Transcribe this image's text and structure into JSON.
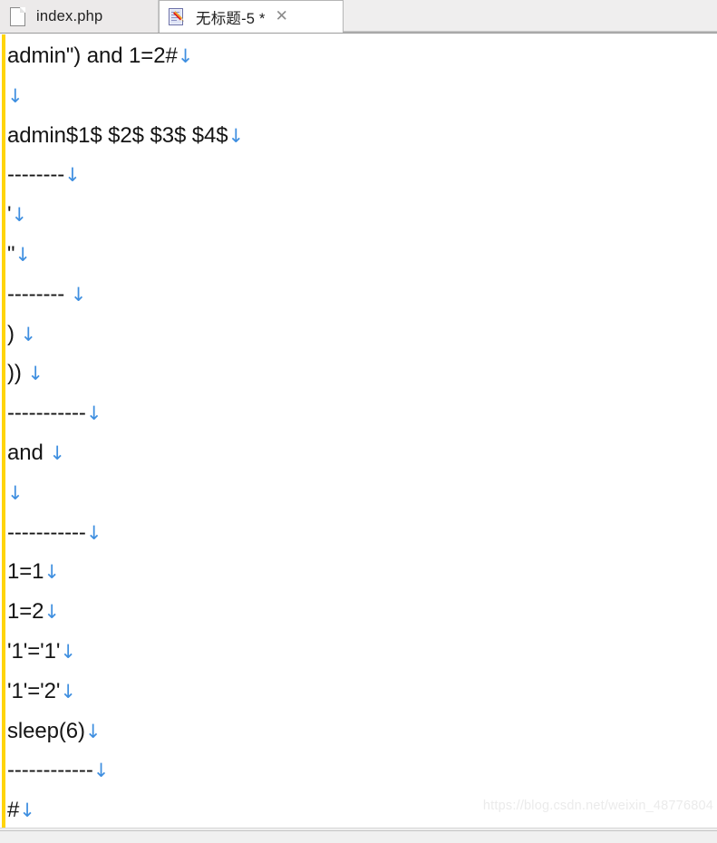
{
  "app": {
    "name": "Notepad++",
    "accent_fold_margin": "#ffd40a",
    "eol_arrow_color": "#3f8fe0",
    "text_color": "#151515"
  },
  "tab_bar": {
    "tabs": [
      {
        "label": "index.php",
        "icon": "page-icon",
        "active": false,
        "modified": false,
        "has_close": false
      },
      {
        "label": "无标题-5 *",
        "icon": "notepad-pencil-icon",
        "active": true,
        "modified": true,
        "has_close": true,
        "close_glyph": "✕"
      }
    ]
  },
  "editor": {
    "eol_glyph": "↓",
    "lines": [
      {
        "text": "admin\") and 1=2#",
        "eol": true
      },
      {
        "text": "",
        "eol": true
      },
      {
        "text": "admin$1$ $2$ $3$ $4$",
        "eol": true
      },
      {
        "text": "--------",
        "eol": true
      },
      {
        "text": "'",
        "eol": true
      },
      {
        "text": "\"",
        "eol": true
      },
      {
        "text": "-------- ",
        "eol": true
      },
      {
        "text": ") ",
        "eol": true
      },
      {
        "text": ")) ",
        "eol": true
      },
      {
        "text": "-----------",
        "eol": true
      },
      {
        "text": "and ",
        "eol": true
      },
      {
        "text": "",
        "eol": true
      },
      {
        "text": "-----------",
        "eol": true
      },
      {
        "text": "1=1",
        "eol": true
      },
      {
        "text": "1=2",
        "eol": true
      },
      {
        "text": "'1'='1'",
        "eol": true
      },
      {
        "text": "'1'='2'",
        "eol": true
      },
      {
        "text": "sleep(6)",
        "eol": true
      },
      {
        "text": "------------",
        "eol": true
      },
      {
        "text": "#",
        "eol": true
      }
    ]
  },
  "watermark": {
    "text": "https://blog.csdn.net/weixin_48776804"
  }
}
